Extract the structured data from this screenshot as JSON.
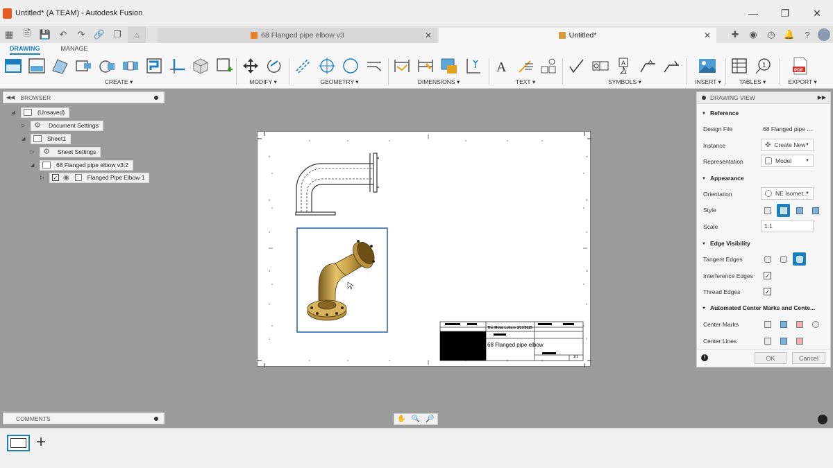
{
  "window": {
    "title": "Untitled* (A TEAM) - Autodesk Fusion",
    "controls": [
      "minimize",
      "maximize",
      "close"
    ]
  },
  "tabs": [
    {
      "label": "68 Flanged pipe elbow v3",
      "active": false,
      "icon_color": "#e8822a"
    },
    {
      "label": "Untitled*",
      "active": true,
      "icon_color": "#d89a3e"
    }
  ],
  "ribbon": {
    "tabs": [
      "DRAWING",
      "MANAGE"
    ],
    "active_tab": "DRAWING",
    "groups": [
      {
        "label": "CREATE ▾"
      },
      {
        "label": "MODIFY ▾"
      },
      {
        "label": "GEOMETRY ▾"
      },
      {
        "label": "DIMENSIONS ▾"
      },
      {
        "label": "TEXT ▾"
      },
      {
        "label": "SYMBOLS ▾"
      },
      {
        "label": "INSERT ▾"
      },
      {
        "label": "TABLES ▾"
      },
      {
        "label": "EXPORT ▾"
      }
    ]
  },
  "browser": {
    "title": "BROWSER",
    "items": [
      {
        "label": "(Unsaved)"
      },
      {
        "label": "Document Settings"
      },
      {
        "label": "Sheet1"
      },
      {
        "label": "Sheet Settings"
      },
      {
        "label": "68 Flanged pipe elbow v3:2"
      },
      {
        "label": "Flanged Pipe Elbow 1"
      }
    ]
  },
  "comments": {
    "title": "COMMENTS"
  },
  "title_block": {
    "title": "68 Flanged pipe elbow",
    "header_text": "The Metal Letters 3/17/2025",
    "sheet_no": "1/1"
  },
  "drawing_view": {
    "title": "DRAWING VIEW",
    "sections": {
      "reference": "Reference",
      "appearance": "Appearance",
      "edge_visibility": "Edge Visibility",
      "center_marks": "Automated Center Marks and Cente..."
    },
    "fields": {
      "design_file_label": "Design File",
      "design_file_value": "68 Flanged pipe ...",
      "instance_label": "Instance",
      "instance_value": "Create New",
      "representation_label": "Representation",
      "representation_value": "Model",
      "orientation_label": "Orientation",
      "orientation_value": "NE Isomet...",
      "style_label": "Style",
      "scale_label": "Scale",
      "scale_value": "1:1",
      "tangent_label": "Tangent Edges",
      "interference_label": "Interference Edges",
      "interference_checked": true,
      "thread_label": "Thread Edges",
      "thread_checked": true,
      "center_marks_label": "Center Marks",
      "center_lines_label": "Center Lines"
    },
    "ok": "OK",
    "cancel": "Cancel"
  }
}
